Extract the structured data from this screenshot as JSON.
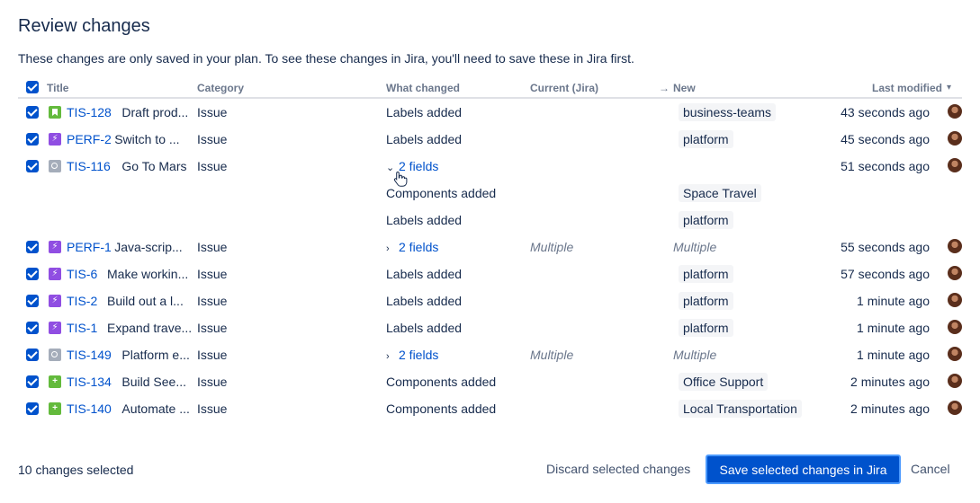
{
  "dialog": {
    "title": "Review changes",
    "description": "These changes are only saved in your plan. To see these changes in Jira, you'll need to save these in Jira first."
  },
  "table": {
    "headers": {
      "title": "Title",
      "category": "Category",
      "what_changed": "What changed",
      "current": "Current (Jira)",
      "new_arrow": "→",
      "new": "New",
      "last_modified": "Last modified",
      "sort_icon": "▾"
    },
    "rows": [
      {
        "icon": "story-icon",
        "key": "TIS-128",
        "summary": "Draft prod...",
        "category": "Issue",
        "what": "Labels added",
        "current": "",
        "new": "business-teams",
        "time": "43 seconds ago"
      },
      {
        "icon": "epic-icon",
        "key": "PERF-2",
        "summary": "Switch to ...",
        "category": "Issue",
        "what": "Labels added",
        "current": "",
        "new": "platform",
        "time": "45 seconds ago"
      },
      {
        "icon": "task-icon",
        "key": "TIS-116",
        "summary": "Go To Mars",
        "category": "Issue",
        "what": "2 fields",
        "current": "",
        "new": "",
        "time": "51 seconds ago",
        "expanded": true,
        "children": [
          {
            "what": "Components added",
            "new": "Space Travel"
          },
          {
            "what": "Labels added",
            "new": "platform"
          }
        ]
      },
      {
        "icon": "epic-icon",
        "key": "PERF-1",
        "summary": "Java-scrip...",
        "category": "Issue",
        "what": "2 fields",
        "current": "Multiple",
        "new": "Multiple",
        "time": "55 seconds ago"
      },
      {
        "icon": "epic-icon",
        "key": "TIS-6",
        "summary": "Make workin...",
        "category": "Issue",
        "what": "Labels added",
        "current": "",
        "new": "platform",
        "time": "57 seconds ago"
      },
      {
        "icon": "epic-icon",
        "key": "TIS-2",
        "summary": "Build out a l...",
        "category": "Issue",
        "what": "Labels added",
        "current": "",
        "new": "platform",
        "time": "1 minute ago"
      },
      {
        "icon": "epic-icon",
        "key": "TIS-1",
        "summary": "Expand trave...",
        "category": "Issue",
        "what": "Labels added",
        "current": "",
        "new": "platform",
        "time": "1 minute ago"
      },
      {
        "icon": "task-icon",
        "key": "TIS-149",
        "summary": "Platform e...",
        "category": "Issue",
        "what": "2 fields",
        "current": "Multiple",
        "new": "Multiple",
        "time": "1 minute ago"
      },
      {
        "icon": "new-feature-icon",
        "key": "TIS-134",
        "summary": "Build See...",
        "category": "Issue",
        "what": "Components added",
        "current": "",
        "new": "Office Support",
        "time": "2 minutes ago"
      },
      {
        "icon": "new-feature-icon",
        "key": "TIS-140",
        "summary": "Automate ...",
        "category": "Issue",
        "what": "Components added",
        "current": "",
        "new": "Local Transportation",
        "time": "2 minutes ago"
      }
    ]
  },
  "footer": {
    "selected_count": "10 changes selected",
    "discard_label": "Discard selected changes",
    "save_label": "Save selected changes in Jira",
    "cancel_label": "Cancel"
  },
  "colors": {
    "accent": "#0052cc",
    "story": "#63ba3c",
    "epic": "#904ee2",
    "task": "#a5adba"
  }
}
